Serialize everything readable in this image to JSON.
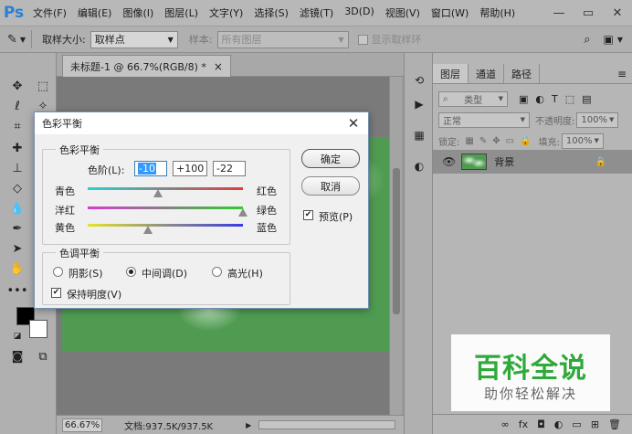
{
  "app": {
    "logo": "Ps"
  },
  "menu": [
    "文件(F)",
    "编辑(E)",
    "图像(I)",
    "图层(L)",
    "文字(Y)",
    "选择(S)",
    "滤镜(T)",
    "3D(D)",
    "视图(V)",
    "窗口(W)",
    "帮助(H)"
  ],
  "window_controls": {
    "minimize": "—",
    "restore": "▭",
    "close": "✕"
  },
  "options": {
    "sample_size_label": "取样大小:",
    "sample_size_value": "取样点",
    "sample_label": "样本:",
    "sample_value": "所有图层",
    "show_ring_label": "显示取样环"
  },
  "document": {
    "tab_title": "未标题-1 @ 66.7%(RGB/8) *",
    "tab_close": "×",
    "zoom": "66.67%",
    "doc_info": "文档:937.5K/937.5K"
  },
  "layers_panel": {
    "tabs": [
      "图层",
      "通道",
      "路径"
    ],
    "filter_label": "类型",
    "blend_mode": "正常",
    "opacity_label": "不透明度:",
    "opacity_value": "100%",
    "lock_label": "锁定:",
    "fill_label": "填充:",
    "fill_value": "100%",
    "layer_name": "背景"
  },
  "dialog": {
    "title": "色彩平衡",
    "color_balance_group": "色彩平衡",
    "levels_label": "色阶(L):",
    "levels": [
      "-10",
      "+100",
      "-22"
    ],
    "sliders": [
      {
        "left": "青色",
        "right": "红色",
        "value": -10
      },
      {
        "left": "洋红",
        "right": "绿色",
        "value": 100
      },
      {
        "left": "黄色",
        "right": "蓝色",
        "value": -22
      }
    ],
    "tone_group": "色调平衡",
    "tones": [
      {
        "label": "阴影(S)",
        "selected": false
      },
      {
        "label": "中间调(D)",
        "selected": true
      },
      {
        "label": "高光(H)",
        "selected": false
      }
    ],
    "preserve_luminosity_label": "保持明度(V)",
    "preserve_luminosity": true,
    "ok_label": "确定",
    "cancel_label": "取消",
    "preview_label": "预览(P)",
    "preview": true
  },
  "watermark": {
    "main": "百科全说",
    "sub": "助你轻松解决"
  },
  "colors": {
    "foreground": "#000000",
    "background": "#ffffff",
    "accent": "#2b7fd4"
  }
}
